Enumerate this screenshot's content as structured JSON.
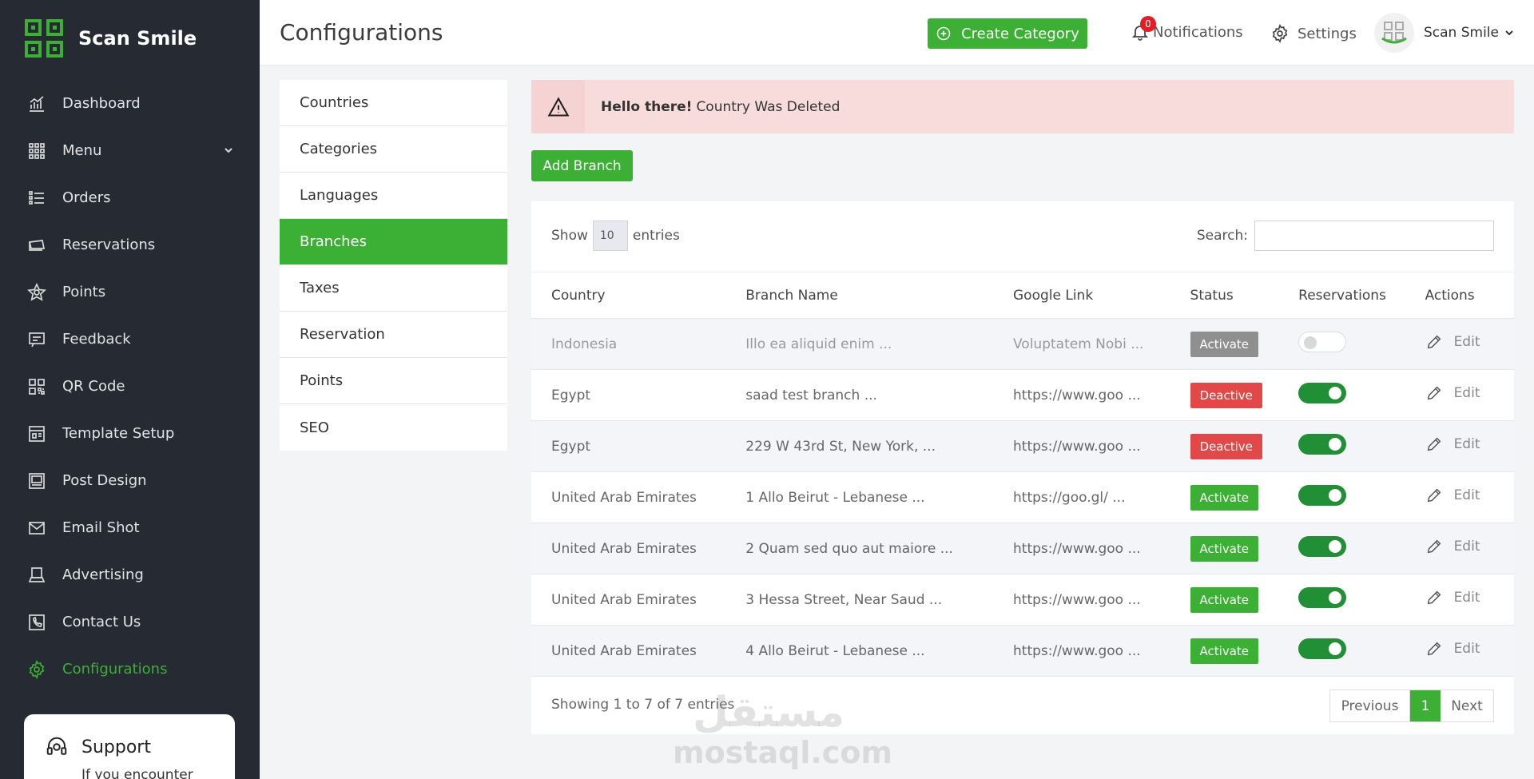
{
  "brand": {
    "name": "Scan Smile"
  },
  "sidebar": {
    "items": [
      {
        "label": "Dashboard",
        "icon": "chart-icon"
      },
      {
        "label": "Menu",
        "icon": "grid-icon",
        "has_submenu": true
      },
      {
        "label": "Orders",
        "icon": "list-icon"
      },
      {
        "label": "Reservations",
        "icon": "ticket-icon"
      },
      {
        "label": "Points",
        "icon": "star-icon"
      },
      {
        "label": "Feedback",
        "icon": "message-icon"
      },
      {
        "label": "QR Code",
        "icon": "qr-icon"
      },
      {
        "label": "Template Setup",
        "icon": "template-icon"
      },
      {
        "label": "Post Design",
        "icon": "image-icon"
      },
      {
        "label": "Email Shot",
        "icon": "mail-icon"
      },
      {
        "label": "Advertising",
        "icon": "laptop-icon"
      },
      {
        "label": "Contact Us",
        "icon": "phone-icon"
      },
      {
        "label": "Configurations",
        "icon": "gear-icon",
        "active": true
      }
    ],
    "support": {
      "title": "Support",
      "text": "If you encounter"
    }
  },
  "header": {
    "title": "Configurations",
    "create_label": "Create Category",
    "notifications_label": "Notifications",
    "notifications_count": "0",
    "settings_label": "Settings",
    "user_name": "Scan Smile"
  },
  "config_menu": {
    "items": [
      "Countries",
      "Categories",
      "Languages",
      "Branches",
      "Taxes",
      "Reservation",
      "Points",
      "SEO"
    ],
    "active": "Branches"
  },
  "alert": {
    "strong": "Hello there!",
    "message": "Country Was Deleted"
  },
  "actions": {
    "add_branch": "Add Branch"
  },
  "table": {
    "show_label": "Show",
    "entries_value": "10",
    "entries_label": "entries",
    "search_label": "Search:",
    "columns": [
      "Country",
      "Branch Name",
      "Google Link",
      "Status",
      "Reservations",
      "Actions"
    ],
    "rows": [
      {
        "country": "Indonesia",
        "branch": "Illo ea aliquid enim ...",
        "link": "Voluptatem Nobi ...",
        "status": "Activate",
        "reservations": false,
        "action": "Edit"
      },
      {
        "country": "Egypt",
        "branch": "saad test branch ...",
        "link": "https://www.goo ...",
        "status": "Deactive",
        "reservations": true,
        "action": "Edit"
      },
      {
        "country": "Egypt",
        "branch": "229 W 43rd St, New York, ...",
        "link": "https://www.goo ...",
        "status": "Deactive",
        "reservations": true,
        "action": "Edit"
      },
      {
        "country": "United Arab Emirates",
        "branch": "1 Allo Beirut - Lebanese ...",
        "link": "https://goo.gl/ ...",
        "status": "Activate",
        "reservations": true,
        "action": "Edit"
      },
      {
        "country": "United Arab Emirates",
        "branch": "2 Quam sed quo aut maiore ...",
        "link": "https://www.goo ...",
        "status": "Activate",
        "reservations": true,
        "action": "Edit"
      },
      {
        "country": "United Arab Emirates",
        "branch": "3 Hessa Street, Near Saud ...",
        "link": "https://www.goo ...",
        "status": "Activate",
        "reservations": true,
        "action": "Edit"
      },
      {
        "country": "United Arab Emirates",
        "branch": "4 Allo Beirut - Lebanese ...",
        "link": "https://www.goo ...",
        "status": "Activate",
        "reservations": true,
        "action": "Edit"
      }
    ],
    "showing": "Showing 1 to 7 of 7 entries",
    "pager": {
      "prev": "Previous",
      "page": "1",
      "next": "Next"
    }
  },
  "watermark": {
    "arabic": "مستقل",
    "latin": "mostaql.com"
  },
  "colors": {
    "accent": "#3cb035",
    "sidebar_bg": "#262a33",
    "danger": "#e34848",
    "alert_bg": "#f8dcdc"
  }
}
